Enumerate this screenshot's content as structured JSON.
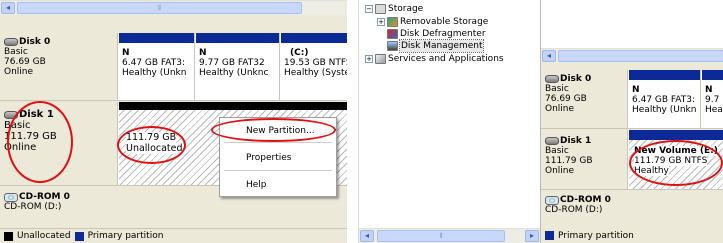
{
  "colors": {
    "primary": "#0b2a97",
    "unallocated": "#000000",
    "highlight_ring": "#e01010"
  },
  "left_panel": {
    "disks": [
      {
        "name": "Disk 0",
        "type": "Basic",
        "size": "76.69 GB",
        "status": "Online",
        "partitions": [
          {
            "label": "N",
            "size_fs": "6.47 GB FAT3:",
            "health": "Healthy (Unkn"
          },
          {
            "label": "N",
            "size_fs": "9.77 GB FAT32",
            "health": "Healthy (Unknc"
          },
          {
            "label": "(C:)",
            "size_fs": "19.53 GB NTFS",
            "health": "Healthy (Systerr"
          }
        ]
      },
      {
        "name": "Disk 1",
        "type": "Basic",
        "size": "111.79 GB",
        "status": "Online",
        "partitions": [
          {
            "size": "111.79 GB",
            "status": "Unallocated"
          }
        ]
      },
      {
        "name": "CD-ROM 0",
        "drive": "CD-ROM (D:)"
      }
    ],
    "legend": {
      "unallocated": "Unallocated",
      "primary": "Primary partition"
    },
    "context_menu": {
      "new_partition": "New Partition...",
      "properties": "Properties",
      "help": "Help"
    }
  },
  "tree": {
    "items": [
      {
        "label": "Storage",
        "expander": "−",
        "icon": "storage-icon"
      },
      {
        "label": "Removable Storage",
        "expander": "+",
        "icon": "removable-storage-icon"
      },
      {
        "label": "Disk Defragmenter",
        "expander": "",
        "icon": "defragmenter-icon"
      },
      {
        "label": "Disk Management",
        "expander": "",
        "icon": "disk-management-icon"
      },
      {
        "label": "Services and Applications",
        "expander": "+",
        "icon": "services-icon"
      }
    ]
  },
  "right_panel": {
    "disks": [
      {
        "name": "Disk 0",
        "type": "Basic",
        "size": "76.69 GB",
        "status": "Online",
        "partitions": [
          {
            "label": "N",
            "size_fs": "6.47 GB FAT3:",
            "health": "Healthy (Unkn"
          },
          {
            "label": "N",
            "size_fs": "9.7",
            "health": "Hea"
          }
        ]
      },
      {
        "name": "Disk 1",
        "type": "Basic",
        "size": "111.79 GB",
        "status": "Online",
        "partitions": [
          {
            "name": "New Volume  (E:)",
            "size_fs": "111.79 GB NTFS",
            "health": "Healthy"
          }
        ]
      },
      {
        "name": "CD-ROM 0",
        "drive": "CD-ROM (D:)"
      }
    ],
    "legend": {
      "primary": "Primary partition"
    }
  },
  "icons": {
    "scroll_left": "◂",
    "scroll_right": "▸",
    "grip": "⦀"
  }
}
